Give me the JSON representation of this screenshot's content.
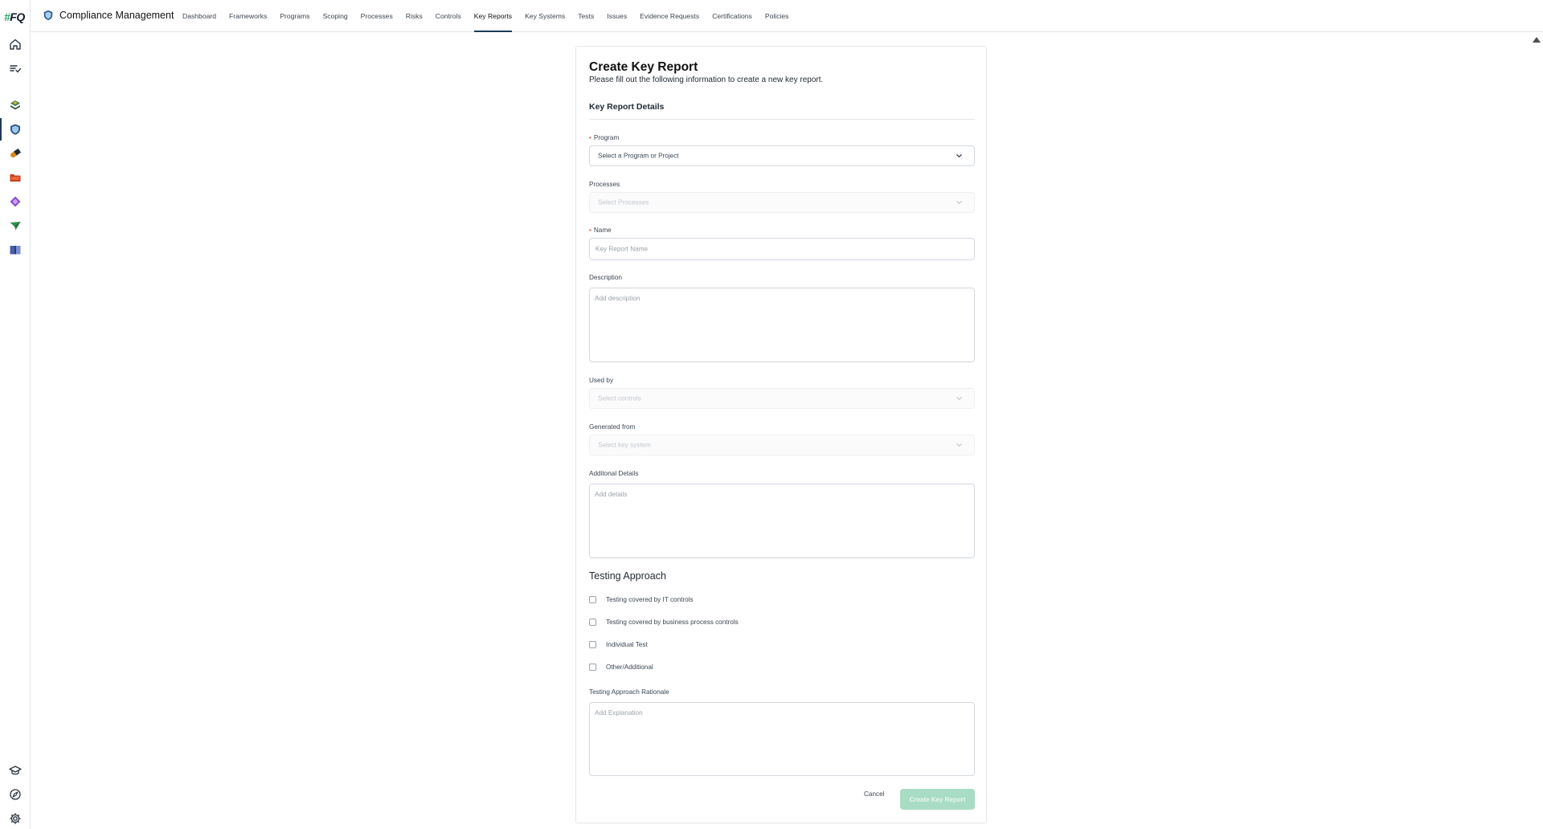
{
  "brand": {
    "logo_hash": "#",
    "logo_text": "FQ",
    "accent": "#2fa36b"
  },
  "rail": {
    "top_icons": [
      "home-icon",
      "tasks-icon"
    ],
    "app_icons": [
      "stack-icon",
      "shield-icon",
      "pill-icon",
      "folder-icon",
      "diamond-icon",
      "plane-icon",
      "book-icon"
    ],
    "bottom_icons": [
      "graduation-cap-icon",
      "compass-icon",
      "gear-icon"
    ]
  },
  "header": {
    "app_title": "Compliance Management",
    "nav": [
      {
        "label": "Dashboard"
      },
      {
        "label": "Frameworks"
      },
      {
        "label": "Programs"
      },
      {
        "label": "Scoping"
      },
      {
        "label": "Processes"
      },
      {
        "label": "Risks"
      },
      {
        "label": "Controls"
      },
      {
        "label": "Key Reports",
        "active": true
      },
      {
        "label": "Key Systems"
      },
      {
        "label": "Tests"
      },
      {
        "label": "Issues"
      },
      {
        "label": "Evidence Requests"
      },
      {
        "label": "Certifications"
      },
      {
        "label": "Policies"
      }
    ]
  },
  "form": {
    "title": "Create Key Report",
    "subtitle": "Please fill out the following information to create a new key report.",
    "section_title": "Key Report Details",
    "program": {
      "label": "Program",
      "value": "Select a Program or Project"
    },
    "processes": {
      "label": "Processes",
      "value": "Select Processes"
    },
    "name": {
      "label": "Name",
      "placeholder": "Key Report Name"
    },
    "description": {
      "label": "Description",
      "placeholder": "Add description"
    },
    "used_by": {
      "label": "Used by",
      "value": "Select controls"
    },
    "generated_from": {
      "label": "Generated from",
      "value": "Select key system"
    },
    "additional_details": {
      "label": "Additonal Details",
      "placeholder": "Add details"
    },
    "testing_approach": {
      "title": "Testing Approach",
      "options": [
        "Testing covered by IT controls",
        "Testing covered by business process controls",
        "Individual Test",
        "Other/Additional"
      ]
    },
    "rationale": {
      "label": "Testing Approach Rationale",
      "placeholder": "Add Explanation"
    },
    "cancel_label": "Cancel",
    "create_label": "Create Key Report"
  }
}
